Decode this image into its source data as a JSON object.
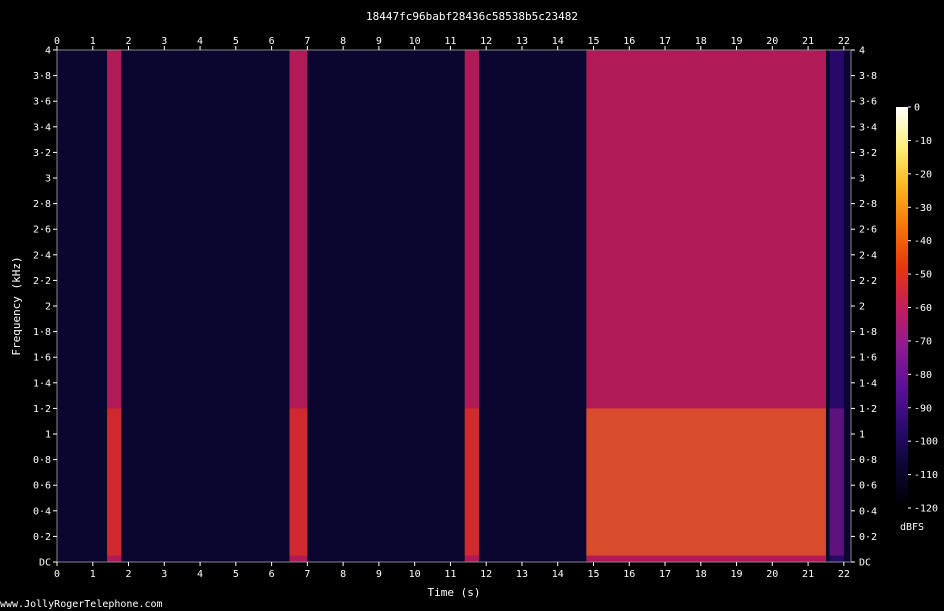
{
  "title": "18447fc96babf28436c58538b5c23482",
  "footer": "www.JollyRogerTelephone.com",
  "chart_data": {
    "type": "heatmap",
    "kind": "spectrogram",
    "xlabel": "Time (s)",
    "ylabel": "Frequency (kHz)",
    "xlim": [
      0,
      22.2
    ],
    "ylim": [
      0,
      4
    ],
    "x_ticks": [
      "0",
      "1",
      "2",
      "3",
      "4",
      "5",
      "6",
      "7",
      "8",
      "9",
      "10",
      "11",
      "12",
      "13",
      "14",
      "15",
      "16",
      "17",
      "18",
      "19",
      "20",
      "21",
      "22"
    ],
    "y_ticks": [
      "DC",
      "0·2",
      "0·4",
      "0·6",
      "0·8",
      "1",
      "1·2",
      "1·4",
      "1·6",
      "1·8",
      "2",
      "2·2",
      "2·4",
      "2·6",
      "2·8",
      "3",
      "3·2",
      "3·4",
      "3·6",
      "3·8",
      "4"
    ],
    "colorbar": {
      "label": "dBFS",
      "range": [
        -120,
        0
      ],
      "ticks": [
        "0",
        "-10",
        "-20",
        "-30",
        "-40",
        "-50",
        "-60",
        "-70",
        "-80",
        "-90",
        "-100",
        "-110",
        "-120"
      ],
      "colors": [
        "#000000",
        "#0b0630",
        "#2a0a6e",
        "#5b0f9a",
        "#8d1a92",
        "#c21e5c",
        "#e8360e",
        "#f5740a",
        "#fbb41e",
        "#fdf07a",
        "#ffffff"
      ]
    },
    "events": [
      {
        "start": 1.4,
        "end": 1.8,
        "level_db": -65
      },
      {
        "start": 6.5,
        "end": 7.0,
        "level_db": -65
      },
      {
        "start": 11.4,
        "end": 11.8,
        "level_db": -65
      },
      {
        "start": 14.8,
        "end": 21.5,
        "level_db": -55
      },
      {
        "start": 21.6,
        "end": 22.0,
        "level_db": -95
      }
    ],
    "background_db": -110
  }
}
